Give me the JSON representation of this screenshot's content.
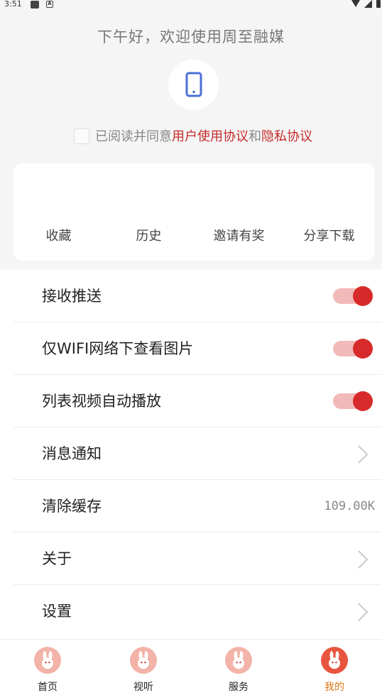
{
  "status_bar": {
    "time": "3:51",
    "notif_icon_a": "A"
  },
  "greeting": "下午好，欢迎使用周至融媒",
  "agreement": {
    "prefix": "已阅读并同意",
    "user_agreement": "用户使用协议",
    "conjunction": "和",
    "privacy_agreement": "隐私协议",
    "checked": false
  },
  "quick_actions": [
    "收藏",
    "历史",
    "邀请有奖",
    "分享下载"
  ],
  "settings": {
    "push": {
      "label": "接收推送",
      "on": true
    },
    "wifi_images": {
      "label": "仅WIFI网络下查看图片",
      "on": true
    },
    "autoplay": {
      "label": "列表视频自动播放",
      "on": true
    },
    "notifications": {
      "label": "消息通知"
    },
    "clear_cache": {
      "label": "清除缓存",
      "value": "109.00K"
    },
    "about": {
      "label": "关于"
    },
    "preferences": {
      "label": "设置"
    }
  },
  "tabs": [
    {
      "label": "首页",
      "icon": "home-mascot-icon",
      "active": false
    },
    {
      "label": "视听",
      "icon": "media-mascot-icon",
      "active": false
    },
    {
      "label": "服务",
      "icon": "service-mascot-icon",
      "active": false
    },
    {
      "label": "我的",
      "icon": "profile-mascot-icon",
      "active": true
    }
  ],
  "colors": {
    "accent_red": "#d72a2a",
    "link_red": "#c72a2a",
    "toggle_track": "#f2b9b9",
    "active_tab": "#e0771c",
    "phone_icon": "#4b6fd6"
  }
}
